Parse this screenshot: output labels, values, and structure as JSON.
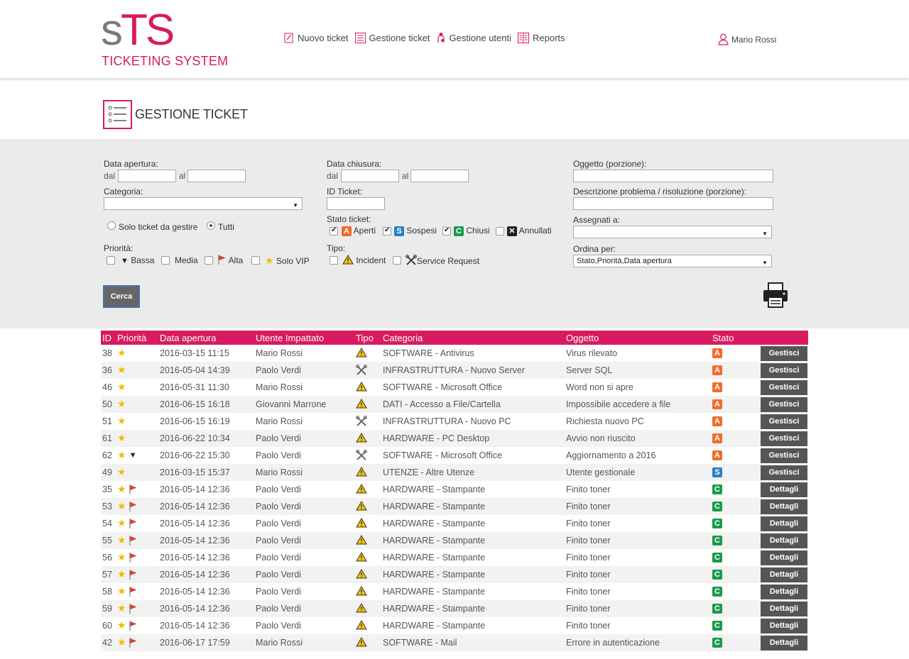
{
  "header": {
    "logo_s": "s",
    "logo_ts": "TS",
    "logo_sub": "TICKETING SYSTEM",
    "nav": [
      {
        "label": "Nuovo ticket",
        "icon": "new-ticket-icon"
      },
      {
        "label": "Gestione ticket",
        "icon": "ticket-list-icon"
      },
      {
        "label": "Gestione utenti",
        "icon": "users-icon"
      },
      {
        "label": "Reports",
        "icon": "reports-icon"
      }
    ],
    "user_name": "Mario Rossi",
    "accent": "#d81b60"
  },
  "page_title": "GESTIONE TICKET",
  "filters": {
    "data_apertura": "Data apertura:",
    "data_chiusura": "Data chiusura:",
    "dal": "dal",
    "al": "al",
    "oggetto": "Oggetto (porzione):",
    "descrizione": "Descrizione problema / risoluzione (porzione):",
    "categoria": "Categoria:",
    "id_ticket": "ID Ticket:",
    "assegnati": "Assegnati a:",
    "solo_gestire": "Solo ticket da gestire",
    "tutti": "Tutti",
    "stato_ticket": "Stato ticket:",
    "aperti": "Aperti",
    "sospesi": "Sospesi",
    "chiusi": "Chiusi",
    "annullati": "Annullati",
    "ordina_per": "Ordina per:",
    "ordina_value": "Stato,Priorità,Data apertura",
    "priorita": "Priorità:",
    "bassa": "Bassa",
    "media": "Media",
    "alta": "Alta",
    "solo_vip": "Solo VIP",
    "tipo": "Tipo:",
    "incident": "Incident",
    "service_request": "Service Request",
    "cerca": "Cerca"
  },
  "table": {
    "headers": [
      "ID",
      "Priorità",
      "Data apertura",
      "Utente Impattato",
      "Tipo",
      "Categoria",
      "Oggetto",
      "Stato"
    ],
    "rows": [
      {
        "id": "38",
        "prio": [
          "vip"
        ],
        "data": "2016-03-15 11:15",
        "utente": "Mario Rossi",
        "tipo": "incident",
        "categoria": "SOFTWARE - Antivirus",
        "oggetto": "Virus rilevato",
        "stato": "A",
        "azione": "Gestisci"
      },
      {
        "id": "36",
        "prio": [
          "vip"
        ],
        "data": "2016-05-04 14:39",
        "utente": "Paolo Verdi",
        "tipo": "service",
        "categoria": "INFRASTRUTTURA - Nuovo Server",
        "oggetto": "Server SQL",
        "stato": "A",
        "azione": "Gestisci"
      },
      {
        "id": "46",
        "prio": [
          "vip"
        ],
        "data": "2016-05-31 11:30",
        "utente": "Mario Rossi",
        "tipo": "incident",
        "categoria": "SOFTWARE - Microsoft Office",
        "oggetto": "Word non si apre",
        "stato": "A",
        "azione": "Gestisci"
      },
      {
        "id": "50",
        "prio": [
          "vip"
        ],
        "data": "2016-06-15 16:18",
        "utente": "Giovanni Marrone",
        "tipo": "incident",
        "categoria": "DATI - Accesso a File/Cartella",
        "oggetto": "Impossibile accedere a file",
        "stato": "A",
        "azione": "Gestisci"
      },
      {
        "id": "51",
        "prio": [
          "vip"
        ],
        "data": "2016-06-15 16:19",
        "utente": "Mario Rossi",
        "tipo": "service",
        "categoria": "INFRASTRUTTURA - Nuovo PC",
        "oggetto": "Richiesta nuovo PC",
        "stato": "A",
        "azione": "Gestisci"
      },
      {
        "id": "61",
        "prio": [
          "vip"
        ],
        "data": "2016-06-22 10:34",
        "utente": "Paolo Verdi",
        "tipo": "incident",
        "categoria": "HARDWARE - PC Desktop",
        "oggetto": "Avvio non riuscito",
        "stato": "A",
        "azione": "Gestisci"
      },
      {
        "id": "62",
        "prio": [
          "vip",
          "low"
        ],
        "data": "2016-06-22 15:30",
        "utente": "Paolo Verdi",
        "tipo": "service",
        "categoria": "SOFTWARE - Microsoft Office",
        "oggetto": "Aggiornamento a 2016",
        "stato": "A",
        "azione": "Gestisci"
      },
      {
        "id": "49",
        "prio": [
          "vip"
        ],
        "data": "2016-03-15 15:37",
        "utente": "Mario Rossi",
        "tipo": "incident",
        "categoria": "UTENZE - Altre Utenze",
        "oggetto": "Utente gestionale",
        "stato": "S",
        "azione": "Gestisci"
      },
      {
        "id": "35",
        "prio": [
          "vip",
          "high"
        ],
        "data": "2016-05-14 12:36",
        "utente": "Paolo Verdi",
        "tipo": "incident",
        "categoria": "HARDWARE - Stampante",
        "oggetto": "Finito toner",
        "stato": "C",
        "azione": "Dettagli"
      },
      {
        "id": "53",
        "prio": [
          "vip",
          "high"
        ],
        "data": "2016-05-14 12:36",
        "utente": "Paolo Verdi",
        "tipo": "incident",
        "categoria": "HARDWARE - Stampante",
        "oggetto": "Finito toner",
        "stato": "C",
        "azione": "Dettagli"
      },
      {
        "id": "54",
        "prio": [
          "vip",
          "high"
        ],
        "data": "2016-05-14 12:36",
        "utente": "Paolo Verdi",
        "tipo": "incident",
        "categoria": "HARDWARE - Stampante",
        "oggetto": "Finito toner",
        "stato": "C",
        "azione": "Dettagli"
      },
      {
        "id": "55",
        "prio": [
          "vip",
          "high"
        ],
        "data": "2016-05-14 12:36",
        "utente": "Paolo Verdi",
        "tipo": "incident",
        "categoria": "HARDWARE - Stampante",
        "oggetto": "Finito toner",
        "stato": "C",
        "azione": "Dettagli"
      },
      {
        "id": "56",
        "prio": [
          "vip",
          "high"
        ],
        "data": "2016-05-14 12:36",
        "utente": "Paolo Verdi",
        "tipo": "incident",
        "categoria": "HARDWARE - Stampante",
        "oggetto": "Finito toner",
        "stato": "C",
        "azione": "Dettagli"
      },
      {
        "id": "57",
        "prio": [
          "vip",
          "high"
        ],
        "data": "2016-05-14 12:36",
        "utente": "Paolo Verdi",
        "tipo": "incident",
        "categoria": "HARDWARE - Stampante",
        "oggetto": "Finito toner",
        "stato": "C",
        "azione": "Dettagli"
      },
      {
        "id": "58",
        "prio": [
          "vip",
          "high"
        ],
        "data": "2016-05-14 12:36",
        "utente": "Paolo Verdi",
        "tipo": "incident",
        "categoria": "HARDWARE - Stampante",
        "oggetto": "Finito toner",
        "stato": "C",
        "azione": "Dettagli"
      },
      {
        "id": "59",
        "prio": [
          "vip",
          "high"
        ],
        "data": "2016-05-14 12:36",
        "utente": "Paolo Verdi",
        "tipo": "incident",
        "categoria": "HARDWARE - Stampante",
        "oggetto": "Finito toner",
        "stato": "C",
        "azione": "Dettagli"
      },
      {
        "id": "60",
        "prio": [
          "vip",
          "high"
        ],
        "data": "2016-05-14 12:36",
        "utente": "Paolo Verdi",
        "tipo": "incident",
        "categoria": "HARDWARE - Stampante",
        "oggetto": "Finito toner",
        "stato": "C",
        "azione": "Dettagli"
      },
      {
        "id": "42",
        "prio": [
          "vip",
          "high"
        ],
        "data": "2016-06-17 17:59",
        "utente": "Mario Rossi",
        "tipo": "incident",
        "categoria": "SOFTWARE - Mail",
        "oggetto": "Errore in autenticazione",
        "stato": "C",
        "azione": "Dettagli"
      }
    ]
  }
}
